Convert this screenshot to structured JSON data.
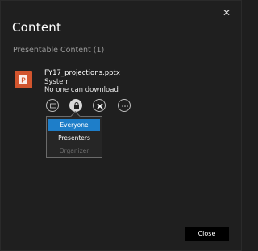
{
  "dialog": {
    "title": "Content",
    "close_icon": "close-icon",
    "section_label": "Presentable Content (1)",
    "close_label": "Close"
  },
  "file": {
    "icon": "powerpoint-file-icon",
    "name": "FY17_projections.pptx",
    "owner": "System",
    "permission": "No one can download"
  },
  "actions": [
    {
      "icon": "present-icon"
    },
    {
      "icon": "lock-icon"
    },
    {
      "icon": "remove-icon"
    },
    {
      "icon": "more-icon"
    }
  ],
  "dropdown": {
    "options": [
      {
        "label": "Everyone",
        "state": "selected"
      },
      {
        "label": "Presenters",
        "state": "normal"
      },
      {
        "label": "Organizer",
        "state": "disabled"
      }
    ]
  },
  "colors": {
    "accent": "#1e7ec9",
    "powerpoint": "#d2552e",
    "background": "#1f1f1f"
  }
}
